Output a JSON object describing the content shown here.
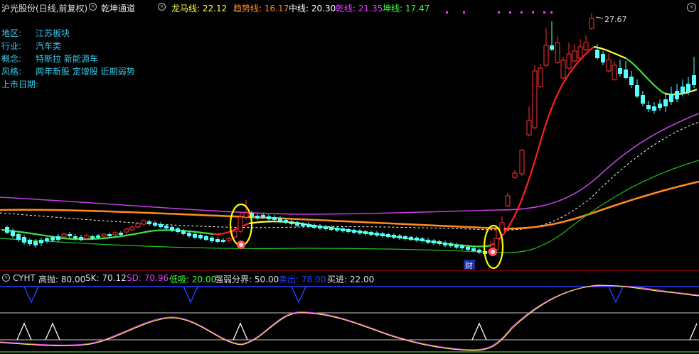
{
  "header": {
    "stock_title": "沪光股份(日线,前复权)",
    "indicator_name": "乾坤通道",
    "lines": [
      {
        "label": "龙马线:",
        "value": "22.12",
        "color": "#ffff40"
      },
      {
        "label": "趋势线:",
        "value": "16.17",
        "color": "#ff8a1f"
      },
      {
        "label": "中线:",
        "value": "20.30",
        "color": "#ffffff"
      },
      {
        "label": "乾线:",
        "value": "21.35",
        "color": "#e040ff"
      },
      {
        "label": "坤线:",
        "value": "17.47",
        "color": "#40ff40"
      }
    ]
  },
  "info": {
    "region_label": "地区:",
    "region_value": "江苏板块",
    "industry_label": "行业:",
    "industry_value": "汽车类",
    "concept_label": "概念:",
    "concept_value": "特斯拉 新能源车",
    "style_label": "风格:",
    "style_value": "两年新股 定增股 近期弱势",
    "listing_label": "上市日期:",
    "listing_value": ""
  },
  "annotations": {
    "high_price": "27.67",
    "finance_marker": "财"
  },
  "sub_header": {
    "name": "CYHT",
    "items": [
      {
        "label": "高抛:",
        "value": "80.00",
        "color": "#e0e0e0"
      },
      {
        "label": "SK:",
        "value": "70.12",
        "color": "#e0e0e0"
      },
      {
        "label": "SD:",
        "value": "70.96",
        "color": "#e040ff"
      },
      {
        "label": "低吸:",
        "value": "20.00",
        "color": "#40ff40"
      },
      {
        "label": "强弱分界:",
        "value": "50.00",
        "color": "#e0e0e0"
      },
      {
        "label": "卖出:",
        "value": "78.00",
        "color": "#2040ff"
      },
      {
        "label": "买进:",
        "value": "22.00",
        "color": "#e0e0e0"
      }
    ]
  },
  "colors": {
    "up_candle": "#ff3232",
    "down_candle": "#54ffff",
    "signal_circle": "#ffff00",
    "magenta_dots": "#ff40ff"
  },
  "icons": {
    "title_button": "circle-close-icon",
    "indicator_button": "circle-close-icon",
    "corner_button": "circle-close-icon"
  }
}
